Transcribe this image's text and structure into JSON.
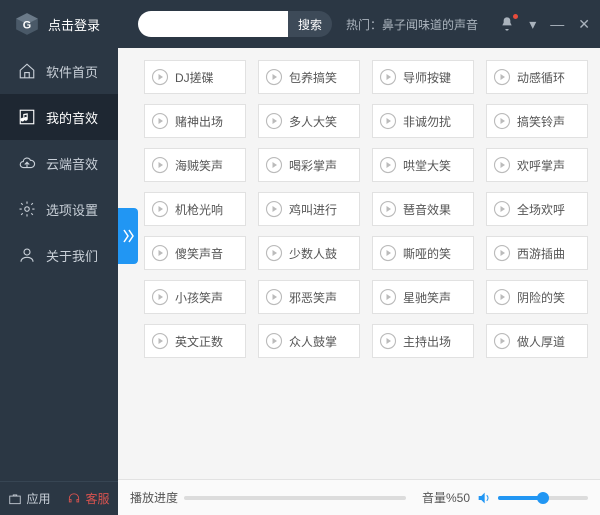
{
  "header": {
    "login_text": "点击登录",
    "search_placeholder": "",
    "search_btn": "搜索",
    "hot_text": "热门：鼻子闻味道的声音"
  },
  "sidebar": {
    "items": [
      {
        "label": "软件首页"
      },
      {
        "label": "我的音效"
      },
      {
        "label": "云端音效"
      },
      {
        "label": "选项设置"
      },
      {
        "label": "关于我们"
      }
    ],
    "bottom": {
      "apps": "应用",
      "cs": "客服"
    }
  },
  "sounds": [
    "DJ搓碟",
    "包养搞笑",
    "导师按键",
    "动感循环",
    "赌神出场",
    "多人大笑",
    "非诚勿扰",
    "搞笑铃声",
    "海贼笑声",
    "喝彩掌声",
    "哄堂大笑",
    "欢呼掌声",
    "机枪光响",
    "鸡叫进行",
    "琶音效果",
    "全场欢呼",
    "傻笑声音",
    "少数人鼓",
    "嘶哑的笑",
    "西游插曲",
    "小孩笑声",
    "邪恶笑声",
    "星驰笑声",
    "阴险的笑",
    "英文正数",
    "众人鼓掌",
    "主持出场",
    "做人厚道"
  ],
  "footer": {
    "progress_label": "播放进度",
    "volume_label": "音量%50",
    "volume_percent": 50
  }
}
